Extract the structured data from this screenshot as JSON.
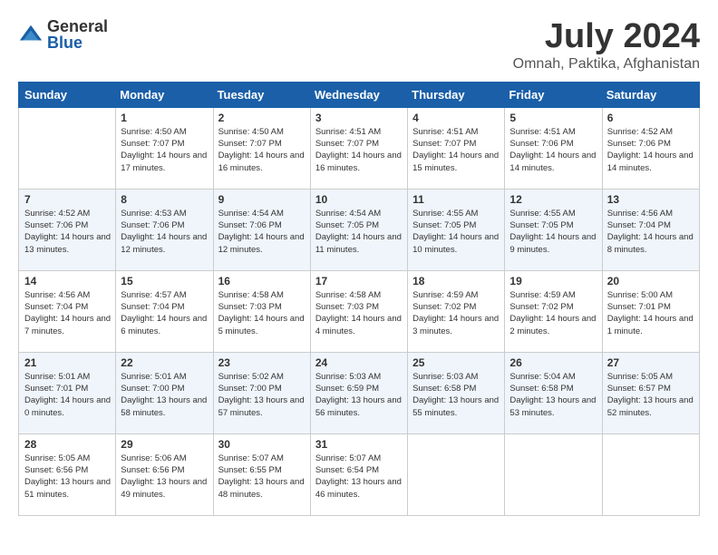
{
  "header": {
    "logo_general": "General",
    "logo_blue": "Blue",
    "month_title": "July 2024",
    "location": "Omnah, Paktika, Afghanistan"
  },
  "days_of_week": [
    "Sunday",
    "Monday",
    "Tuesday",
    "Wednesday",
    "Thursday",
    "Friday",
    "Saturday"
  ],
  "weeks": [
    [
      {
        "day": "",
        "sunrise": "",
        "sunset": "",
        "daylight": ""
      },
      {
        "day": "1",
        "sunrise": "Sunrise: 4:50 AM",
        "sunset": "Sunset: 7:07 PM",
        "daylight": "Daylight: 14 hours and 17 minutes."
      },
      {
        "day": "2",
        "sunrise": "Sunrise: 4:50 AM",
        "sunset": "Sunset: 7:07 PM",
        "daylight": "Daylight: 14 hours and 16 minutes."
      },
      {
        "day": "3",
        "sunrise": "Sunrise: 4:51 AM",
        "sunset": "Sunset: 7:07 PM",
        "daylight": "Daylight: 14 hours and 16 minutes."
      },
      {
        "day": "4",
        "sunrise": "Sunrise: 4:51 AM",
        "sunset": "Sunset: 7:07 PM",
        "daylight": "Daylight: 14 hours and 15 minutes."
      },
      {
        "day": "5",
        "sunrise": "Sunrise: 4:51 AM",
        "sunset": "Sunset: 7:06 PM",
        "daylight": "Daylight: 14 hours and 14 minutes."
      },
      {
        "day": "6",
        "sunrise": "Sunrise: 4:52 AM",
        "sunset": "Sunset: 7:06 PM",
        "daylight": "Daylight: 14 hours and 14 minutes."
      }
    ],
    [
      {
        "day": "7",
        "sunrise": "Sunrise: 4:52 AM",
        "sunset": "Sunset: 7:06 PM",
        "daylight": "Daylight: 14 hours and 13 minutes."
      },
      {
        "day": "8",
        "sunrise": "Sunrise: 4:53 AM",
        "sunset": "Sunset: 7:06 PM",
        "daylight": "Daylight: 14 hours and 12 minutes."
      },
      {
        "day": "9",
        "sunrise": "Sunrise: 4:54 AM",
        "sunset": "Sunset: 7:06 PM",
        "daylight": "Daylight: 14 hours and 12 minutes."
      },
      {
        "day": "10",
        "sunrise": "Sunrise: 4:54 AM",
        "sunset": "Sunset: 7:05 PM",
        "daylight": "Daylight: 14 hours and 11 minutes."
      },
      {
        "day": "11",
        "sunrise": "Sunrise: 4:55 AM",
        "sunset": "Sunset: 7:05 PM",
        "daylight": "Daylight: 14 hours and 10 minutes."
      },
      {
        "day": "12",
        "sunrise": "Sunrise: 4:55 AM",
        "sunset": "Sunset: 7:05 PM",
        "daylight": "Daylight: 14 hours and 9 minutes."
      },
      {
        "day": "13",
        "sunrise": "Sunrise: 4:56 AM",
        "sunset": "Sunset: 7:04 PM",
        "daylight": "Daylight: 14 hours and 8 minutes."
      }
    ],
    [
      {
        "day": "14",
        "sunrise": "Sunrise: 4:56 AM",
        "sunset": "Sunset: 7:04 PM",
        "daylight": "Daylight: 14 hours and 7 minutes."
      },
      {
        "day": "15",
        "sunrise": "Sunrise: 4:57 AM",
        "sunset": "Sunset: 7:04 PM",
        "daylight": "Daylight: 14 hours and 6 minutes."
      },
      {
        "day": "16",
        "sunrise": "Sunrise: 4:58 AM",
        "sunset": "Sunset: 7:03 PM",
        "daylight": "Daylight: 14 hours and 5 minutes."
      },
      {
        "day": "17",
        "sunrise": "Sunrise: 4:58 AM",
        "sunset": "Sunset: 7:03 PM",
        "daylight": "Daylight: 14 hours and 4 minutes."
      },
      {
        "day": "18",
        "sunrise": "Sunrise: 4:59 AM",
        "sunset": "Sunset: 7:02 PM",
        "daylight": "Daylight: 14 hours and 3 minutes."
      },
      {
        "day": "19",
        "sunrise": "Sunrise: 4:59 AM",
        "sunset": "Sunset: 7:02 PM",
        "daylight": "Daylight: 14 hours and 2 minutes."
      },
      {
        "day": "20",
        "sunrise": "Sunrise: 5:00 AM",
        "sunset": "Sunset: 7:01 PM",
        "daylight": "Daylight: 14 hours and 1 minute."
      }
    ],
    [
      {
        "day": "21",
        "sunrise": "Sunrise: 5:01 AM",
        "sunset": "Sunset: 7:01 PM",
        "daylight": "Daylight: 14 hours and 0 minutes."
      },
      {
        "day": "22",
        "sunrise": "Sunrise: 5:01 AM",
        "sunset": "Sunset: 7:00 PM",
        "daylight": "Daylight: 13 hours and 58 minutes."
      },
      {
        "day": "23",
        "sunrise": "Sunrise: 5:02 AM",
        "sunset": "Sunset: 7:00 PM",
        "daylight": "Daylight: 13 hours and 57 minutes."
      },
      {
        "day": "24",
        "sunrise": "Sunrise: 5:03 AM",
        "sunset": "Sunset: 6:59 PM",
        "daylight": "Daylight: 13 hours and 56 minutes."
      },
      {
        "day": "25",
        "sunrise": "Sunrise: 5:03 AM",
        "sunset": "Sunset: 6:58 PM",
        "daylight": "Daylight: 13 hours and 55 minutes."
      },
      {
        "day": "26",
        "sunrise": "Sunrise: 5:04 AM",
        "sunset": "Sunset: 6:58 PM",
        "daylight": "Daylight: 13 hours and 53 minutes."
      },
      {
        "day": "27",
        "sunrise": "Sunrise: 5:05 AM",
        "sunset": "Sunset: 6:57 PM",
        "daylight": "Daylight: 13 hours and 52 minutes."
      }
    ],
    [
      {
        "day": "28",
        "sunrise": "Sunrise: 5:05 AM",
        "sunset": "Sunset: 6:56 PM",
        "daylight": "Daylight: 13 hours and 51 minutes."
      },
      {
        "day": "29",
        "sunrise": "Sunrise: 5:06 AM",
        "sunset": "Sunset: 6:56 PM",
        "daylight": "Daylight: 13 hours and 49 minutes."
      },
      {
        "day": "30",
        "sunrise": "Sunrise: 5:07 AM",
        "sunset": "Sunset: 6:55 PM",
        "daylight": "Daylight: 13 hours and 48 minutes."
      },
      {
        "day": "31",
        "sunrise": "Sunrise: 5:07 AM",
        "sunset": "Sunset: 6:54 PM",
        "daylight": "Daylight: 13 hours and 46 minutes."
      },
      {
        "day": "",
        "sunrise": "",
        "sunset": "",
        "daylight": ""
      },
      {
        "day": "",
        "sunrise": "",
        "sunset": "",
        "daylight": ""
      },
      {
        "day": "",
        "sunrise": "",
        "sunset": "",
        "daylight": ""
      }
    ]
  ]
}
